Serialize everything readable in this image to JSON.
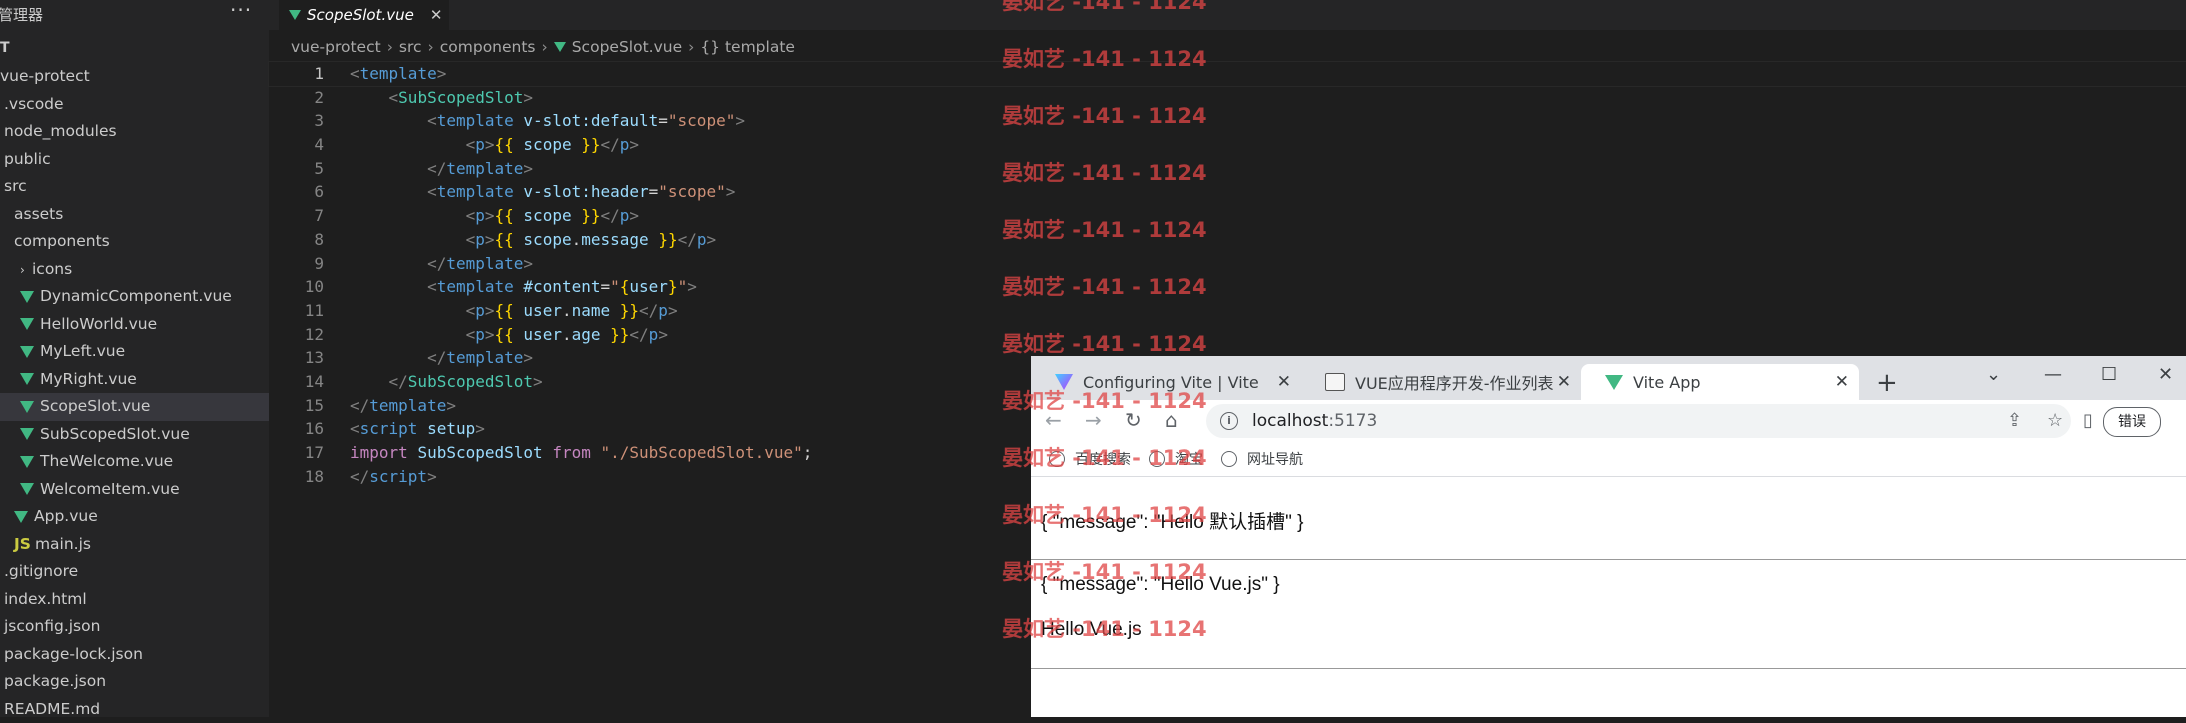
{
  "explorer": {
    "title": "资源管理器",
    "more": "···",
    "section": "T",
    "items": [
      {
        "label": "vue-protect",
        "kind": "folder"
      },
      {
        "label": ".vscode",
        "kind": "folder"
      },
      {
        "label": "node_modules",
        "kind": "folder"
      },
      {
        "label": "public",
        "kind": "folder"
      },
      {
        "label": "src",
        "kind": "folder"
      },
      {
        "label": "assets",
        "kind": "folder"
      },
      {
        "label": "components",
        "kind": "folder"
      },
      {
        "label": "icons",
        "kind": "folder"
      },
      {
        "label": "DynamicComponent.vue",
        "kind": "vue"
      },
      {
        "label": "HelloWorld.vue",
        "kind": "vue"
      },
      {
        "label": "MyLeft.vue",
        "kind": "vue"
      },
      {
        "label": "MyRight.vue",
        "kind": "vue"
      },
      {
        "label": "ScopeSlot.vue",
        "kind": "vue",
        "selected": true
      },
      {
        "label": "SubScopedSlot.vue",
        "kind": "vue"
      },
      {
        "label": "TheWelcome.vue",
        "kind": "vue"
      },
      {
        "label": "WelcomeItem.vue",
        "kind": "vue"
      },
      {
        "label": "App.vue",
        "kind": "vue"
      },
      {
        "label": "main.js",
        "kind": "js"
      },
      {
        "label": ".gitignore",
        "kind": "file"
      },
      {
        "label": "index.html",
        "kind": "file"
      },
      {
        "label": "jsconfig.json",
        "kind": "file"
      },
      {
        "label": "package-lock.json",
        "kind": "file"
      },
      {
        "label": "package.json",
        "kind": "file"
      },
      {
        "label": "README.md",
        "kind": "file"
      }
    ]
  },
  "editor": {
    "tab_label": "ScopeSlot.vue",
    "tab_close": "✕",
    "breadcrumb": [
      "vue-protect",
      "src",
      "components",
      "ScopeSlot.vue",
      "{} template"
    ],
    "line_numbers": [
      "1",
      "2",
      "3",
      "4",
      "5",
      "6",
      "7",
      "8",
      "9",
      "10",
      "11",
      "12",
      "13",
      "14",
      "15",
      "16",
      "17",
      "18"
    ]
  },
  "watermark": {
    "text": "晏如艺 -141 - 1124",
    "count": 12
  },
  "browser": {
    "tabs": [
      {
        "label": "Configuring Vite | Vite",
        "close": "✕"
      },
      {
        "label": "VUE应用程序开发-作业列表",
        "close": "✕"
      },
      {
        "label": "Vite App",
        "close": "✕"
      }
    ],
    "new_tab": "+",
    "window_controls": [
      "⌄",
      "—",
      "☐",
      "✕"
    ],
    "url_host": "localhost",
    "url_port": ":5173",
    "error_button": "错误",
    "bookmarks": [
      "百度搜索",
      "淘宝",
      "网址导航"
    ],
    "page_lines": [
      "{ \"message\": \"Hello 默认插槽\" }",
      "{ \"message\": \"Hello Vue.js\" }",
      "Hello Vue.js"
    ]
  }
}
